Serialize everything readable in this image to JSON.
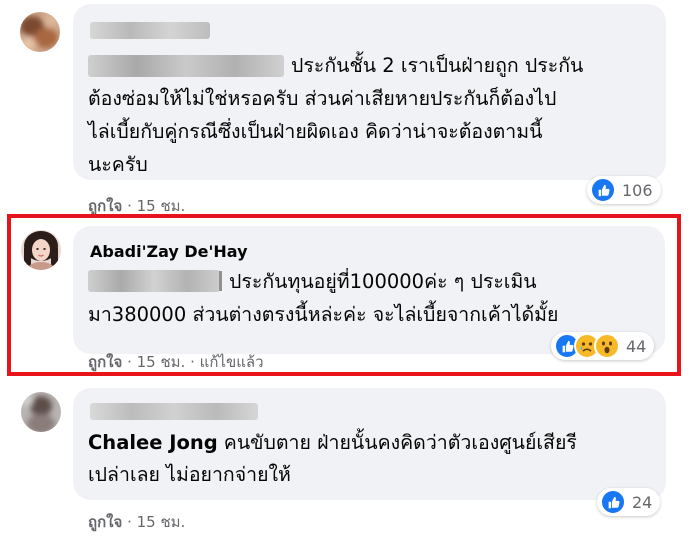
{
  "colors": {
    "bubble_bg": "#f0f2f5",
    "meta_text": "#65676b",
    "highlight_border": "#e8141c",
    "like_blue": "#1877f2",
    "haha_yellow": "#f7b928"
  },
  "comments": [
    {
      "author": "",
      "body_lines": [
        "ประกันชั้น 2 เราเป็นฝ่ายถูก ประกัน",
        "ต้องซ่อมให้ไม่ใช่หรอครับ ส่วนค่าเสียหายประกันก็ต้องไป",
        "ไล่เบี้ยกับคู่กรณีซึ่งเป็นฝ่ายผิดเอง คิดว่าน่าจะต้องตามนี้",
        "นะครับ"
      ],
      "like_label": "ถูกใจ",
      "separator": "·",
      "time": "15 ชม.",
      "edited": "",
      "reactions": [
        "like-icon"
      ],
      "reaction_count": "106"
    },
    {
      "author": "Abadi'Zay De'Hay",
      "body_lines": [
        "ประกันทุนอยู่ที่100000ค่ะ ๆ ประเมิน",
        "มา380000 ส่วนต่างตรงนี้หล่ะค่ะ จะไล่เบี้ยจากเค้าได้มั้ย"
      ],
      "like_label": "ถูกใจ",
      "separator": "·",
      "time": "15 ชม.",
      "edited": "แก้ไขแล้ว",
      "reactions": [
        "like-icon",
        "sad-icon",
        "wow-icon"
      ],
      "reaction_count": "44"
    },
    {
      "author": "",
      "mention": "Chalee Jong",
      "body_lines": [
        "คนขับตาย ฝ่ายนั้นคงคิดว่าตัวเองศูนย์เสียรี",
        "เปล่าเลย ไม่อยากจ่ายให้"
      ],
      "like_label": "ถูกใจ",
      "separator": "·",
      "time": "15 ชม.",
      "edited": "",
      "reactions": [
        "like-icon"
      ],
      "reaction_count": "24"
    }
  ]
}
